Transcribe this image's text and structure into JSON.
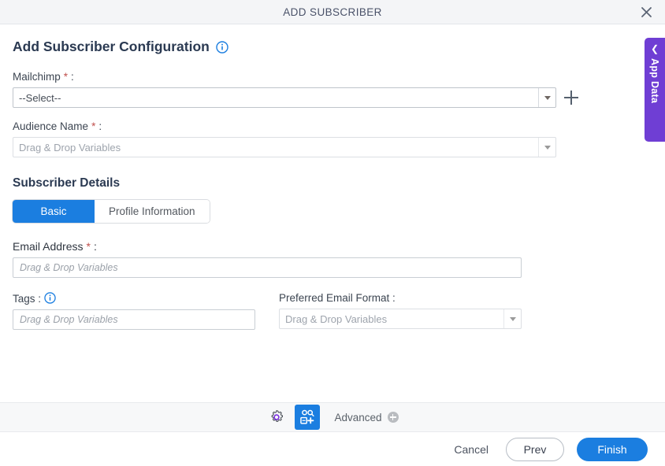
{
  "window": {
    "title": "ADD SUBSCRIBER",
    "close_icon": "close-icon"
  },
  "page": {
    "heading": "Add Subscriber Configuration",
    "heading_info_icon": "info-icon"
  },
  "fields": {
    "mailchimp": {
      "label": "Mailchimp",
      "required": "*",
      "colon": ":",
      "value": "--Select--",
      "add_icon": "plus-icon"
    },
    "audience_name": {
      "label": "Audience Name",
      "required": "*",
      "colon": ":",
      "placeholder": "Drag & Drop Variables"
    }
  },
  "subscriber_details": {
    "title": "Subscriber Details",
    "tabs": [
      {
        "label": "Basic",
        "active": true
      },
      {
        "label": "Profile Information",
        "active": false
      }
    ],
    "basic": {
      "email_address": {
        "label": "Email Address",
        "required": "*",
        "colon": ":",
        "placeholder": "Drag & Drop Variables"
      },
      "tags": {
        "label": "Tags :",
        "info_icon": "info-icon",
        "placeholder": "Drag & Drop Variables"
      },
      "preferred_email_format": {
        "label": "Preferred Email Format :",
        "placeholder": "Drag & Drop Variables"
      }
    }
  },
  "toolbar": {
    "settings_icon": "gear-icon",
    "add_subscriber_icon": "add-subscriber-icon",
    "advanced_label": "Advanced",
    "advanced_add_icon": "circle-plus-icon"
  },
  "footer": {
    "cancel_label": "Cancel",
    "prev_label": "Prev",
    "finish_label": "Finish"
  },
  "app_data_panel": {
    "label": "App Data",
    "chevron_icon": "chevron-left-icon"
  },
  "colors": {
    "primary_blue": "#1b7ee0",
    "purple": "#6f3ed4",
    "required_red": "#c0504d",
    "title_navy": "#2b3a52",
    "toolbar_bg": "#f7f8f9"
  }
}
